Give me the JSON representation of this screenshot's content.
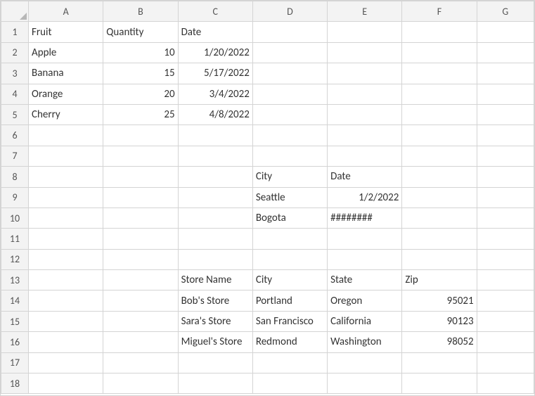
{
  "columns": [
    "A",
    "B",
    "C",
    "D",
    "E",
    "F",
    "G"
  ],
  "rows": [
    "1",
    "2",
    "3",
    "4",
    "5",
    "6",
    "7",
    "8",
    "9",
    "10",
    "11",
    "12",
    "13",
    "14",
    "15",
    "16",
    "17",
    "18"
  ],
  "cells": {
    "r1": {
      "A": "Fruit",
      "B": "Quantity",
      "C": "Date"
    },
    "r2": {
      "A": "Apple",
      "B": "10",
      "C": "1/20/2022"
    },
    "r3": {
      "A": "Banana",
      "B": "15",
      "C": "5/17/2022"
    },
    "r4": {
      "A": "Orange",
      "B": "20",
      "C": "3/4/2022"
    },
    "r5": {
      "A": "Cherry",
      "B": "25",
      "C": "4/8/2022"
    },
    "r8": {
      "D": "City",
      "E": "Date"
    },
    "r9": {
      "D": "Seattle",
      "E": "1/2/2022"
    },
    "r10": {
      "D": "Bogota",
      "E": "########"
    },
    "r13": {
      "C": "Store Name",
      "D": "City",
      "E": "State",
      "F": "Zip"
    },
    "r14": {
      "C": "Bob's Store",
      "D": "Portland",
      "E": "Oregon",
      "F": "95021"
    },
    "r15": {
      "C": "Sara's Store",
      "D": "San Francisco",
      "E": "California",
      "F": "90123"
    },
    "r16": {
      "C": "Miguel's Store",
      "D": "Redmond",
      "E": "Washington",
      "F": "98052"
    }
  },
  "chart_data": [
    {
      "type": "table",
      "title": "Fruit inventory",
      "columns": [
        "Fruit",
        "Quantity",
        "Date"
      ],
      "rows": [
        [
          "Apple",
          10,
          "1/20/2022"
        ],
        [
          "Banana",
          15,
          "5/17/2022"
        ],
        [
          "Orange",
          20,
          "3/4/2022"
        ],
        [
          "Cherry",
          25,
          "4/8/2022"
        ]
      ]
    },
    {
      "type": "table",
      "title": "City dates",
      "columns": [
        "City",
        "Date"
      ],
      "rows": [
        [
          "Seattle",
          "1/2/2022"
        ],
        [
          "Bogota",
          "########"
        ]
      ]
    },
    {
      "type": "table",
      "title": "Stores",
      "columns": [
        "Store Name",
        "City",
        "State",
        "Zip"
      ],
      "rows": [
        [
          "Bob's Store",
          "Portland",
          "Oregon",
          95021
        ],
        [
          "Sara's Store",
          "San Francisco",
          "California",
          90123
        ],
        [
          "Miguel's Store",
          "Redmond",
          "Washington",
          98052
        ]
      ]
    }
  ]
}
